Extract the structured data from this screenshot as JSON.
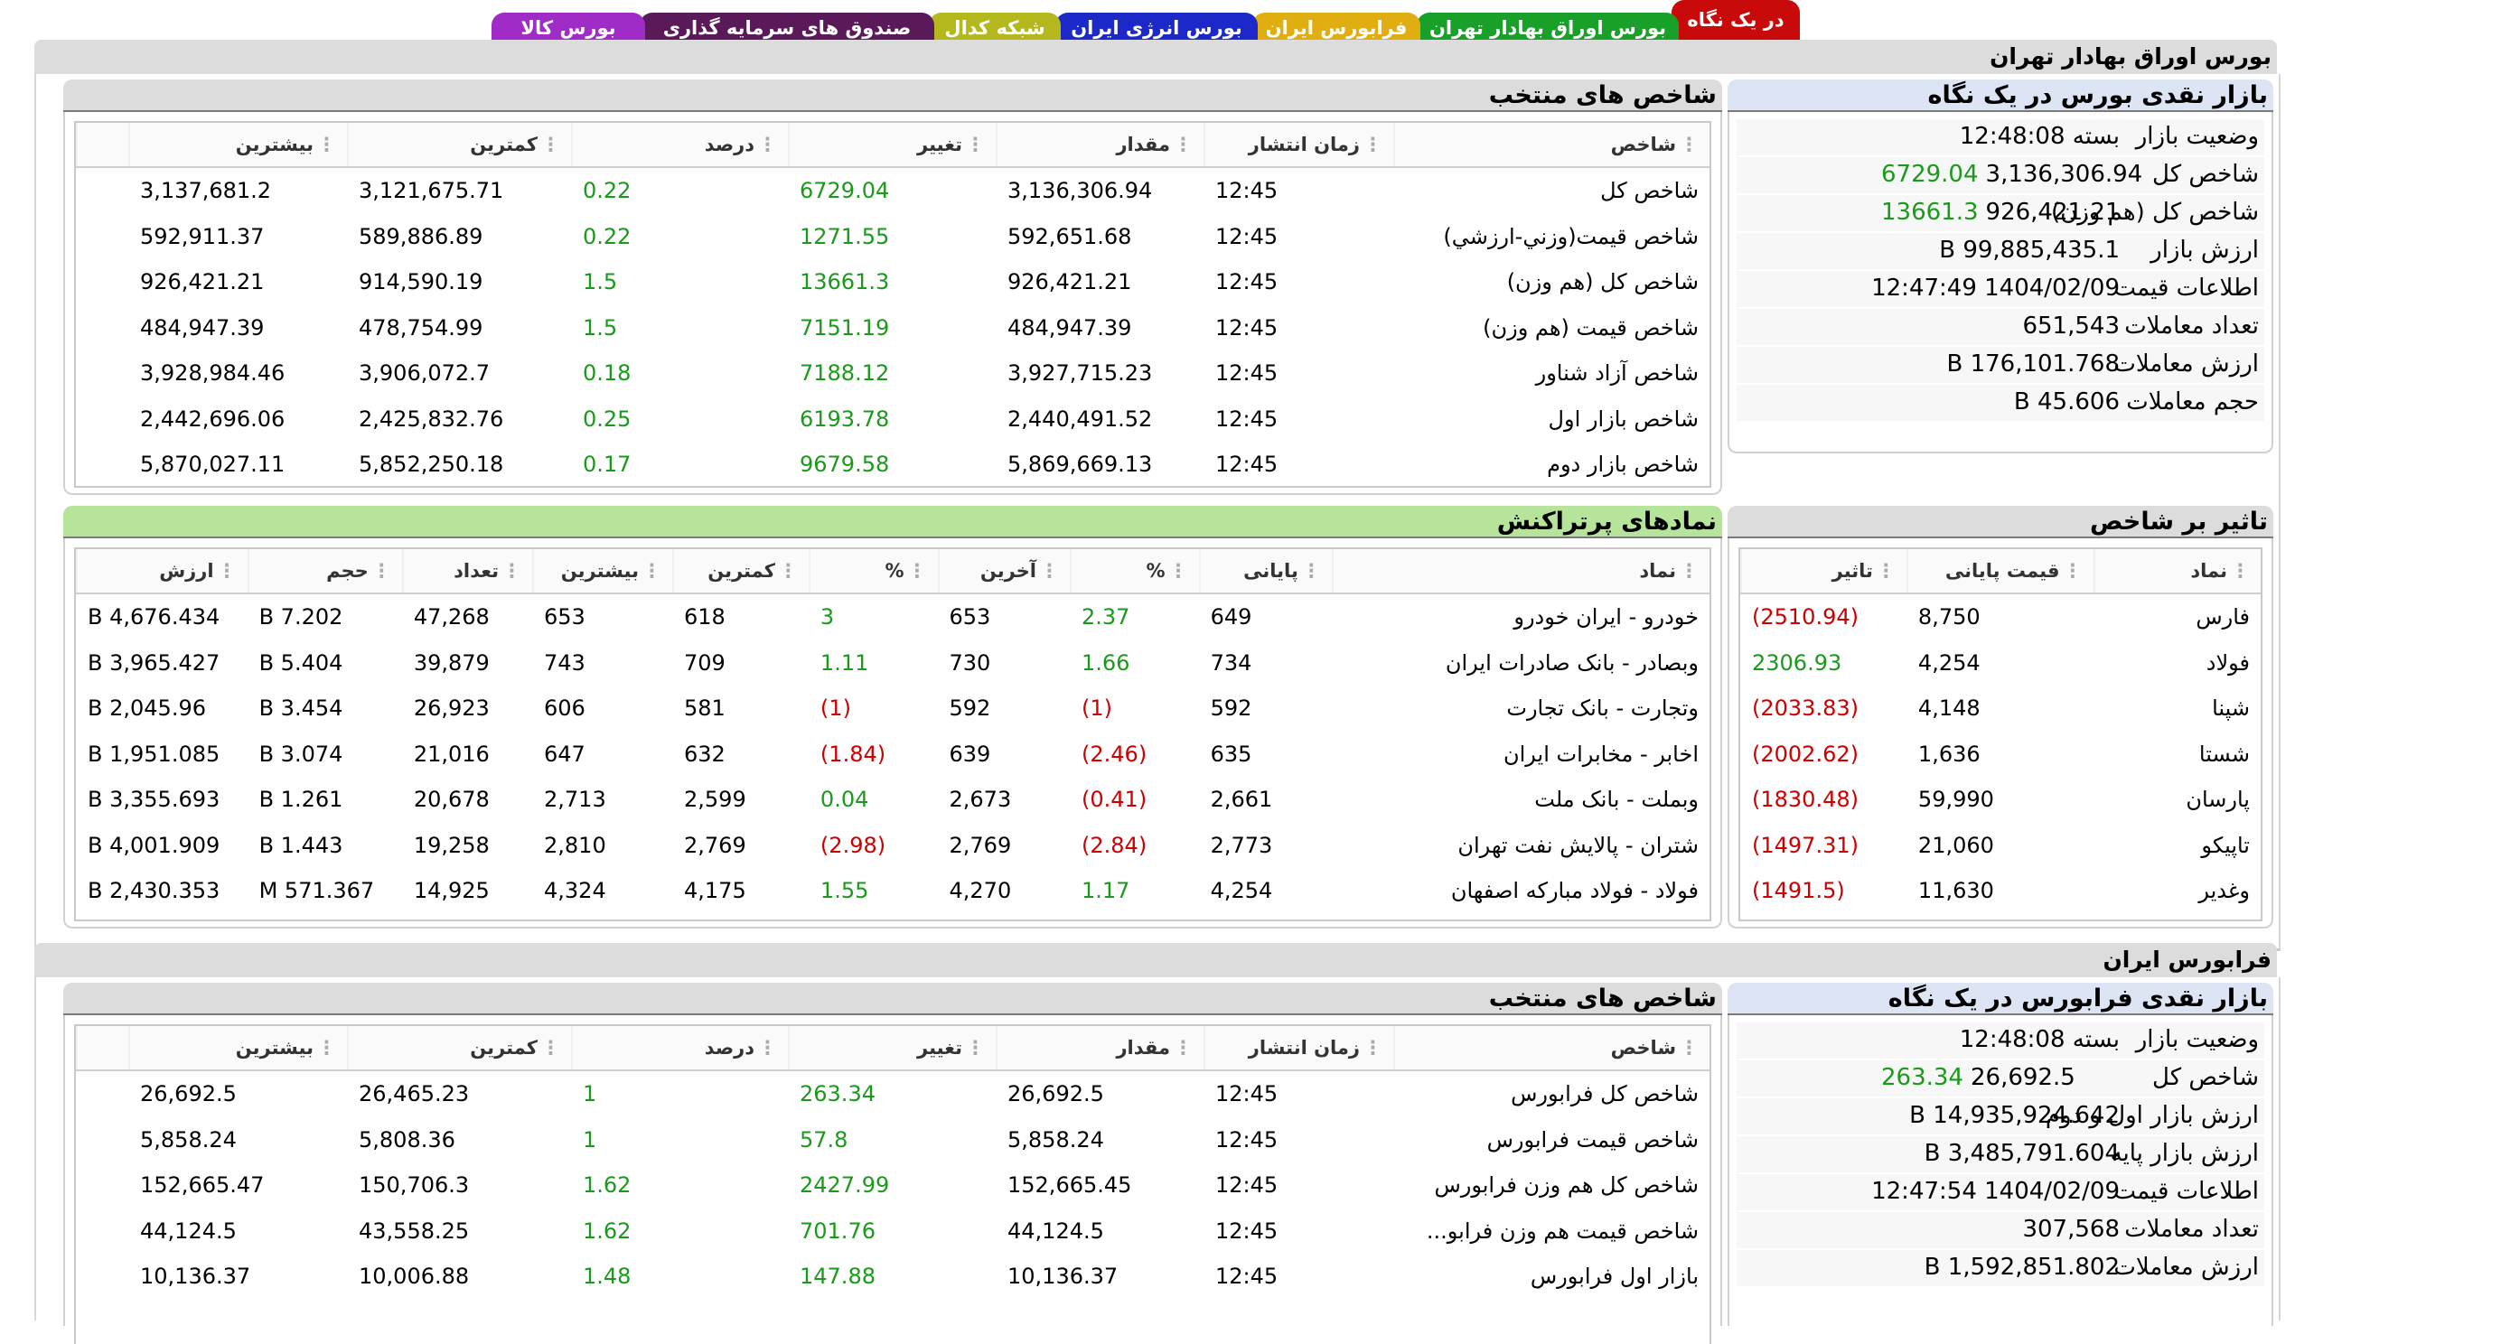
{
  "tabs": [
    {
      "label": "در یک نگاه",
      "color": "#c80a0a",
      "active": true
    },
    {
      "label": "بورس اوراق بهادار تهران",
      "color": "#18a028"
    },
    {
      "label": "فرابورس ایران",
      "color": "#e0ae10"
    },
    {
      "label": "بورس انرژی ایران",
      "color": "#1c28c8"
    },
    {
      "label": "شبکه کدال",
      "color": "#b4b81c"
    },
    {
      "label": "صندوق های سرمایه گذاری",
      "color": "#5a1a5a"
    },
    {
      "label": "بورس کالا",
      "color": "#a02cc8"
    }
  ],
  "tehran": {
    "title": "بورس اوراق بهادار تهران",
    "summary": {
      "title": "بازار نقدی بورس در یک نگاه",
      "rows": [
        {
          "label": "وضعیت بازار",
          "value": "بسته 12:48:08"
        },
        {
          "label": "شاخص کل",
          "value": "3,136,306.94",
          "change": "6729.04"
        },
        {
          "label": "شاخص کل (هم وزن)",
          "value": "926,421.21",
          "change": "13661.3"
        },
        {
          "label": "ارزش بازار",
          "value": "99,885,435.1 B"
        },
        {
          "label": "اطلاعات قیمت",
          "value": "1404/02/09 12:47:49"
        },
        {
          "label": "تعداد معاملات",
          "value": "651,543"
        },
        {
          "label": "ارزش معاملات",
          "value": "176,101.768 B"
        },
        {
          "label": "حجم معاملات",
          "value": "45.606 B"
        }
      ]
    },
    "indices": {
      "title": "شاخص های منتخب",
      "headers": [
        "شاخص",
        "زمان انتشار",
        "مقدار",
        "تغییر",
        "درصد",
        "کمترین",
        "بیشترین"
      ],
      "rows": [
        [
          "شاخص کل",
          "12:45",
          "3,136,306.94",
          "6729.04",
          "0.22",
          "3,121,675.71",
          "3,137,681.2"
        ],
        [
          "شاخص قيمت(وزني-ارزشي)",
          "12:45",
          "592,651.68",
          "1271.55",
          "0.22",
          "589,886.89",
          "592,911.37"
        ],
        [
          "شاخص کل (هم وزن)",
          "12:45",
          "926,421.21",
          "13661.3",
          "1.5",
          "914,590.19",
          "926,421.21"
        ],
        [
          "شاخص قیمت (هم وزن)",
          "12:45",
          "484,947.39",
          "7151.19",
          "1.5",
          "478,754.99",
          "484,947.39"
        ],
        [
          "شاخص آزاد شناور",
          "12:45",
          "3,927,715.23",
          "7188.12",
          "0.18",
          "3,906,072.7",
          "3,928,984.46"
        ],
        [
          "شاخص بازار اول",
          "12:45",
          "2,440,491.52",
          "6193.78",
          "0.25",
          "2,425,832.76",
          "2,442,696.06"
        ],
        [
          "شاخص بازار دوم",
          "12:45",
          "5,869,669.13",
          "9679.58",
          "0.17",
          "5,852,250.18",
          "5,870,027.11"
        ]
      ]
    },
    "impact": {
      "title": "تاثیر بر شاخص",
      "headers": [
        "نماد",
        "قیمت پایانی",
        "تاثیر"
      ],
      "rows": [
        [
          "فارس",
          "8,750",
          "(2510.94)"
        ],
        [
          "فولاد",
          "4,254",
          "2306.93"
        ],
        [
          "شپنا",
          "4,148",
          "(2033.83)"
        ],
        [
          "شستا",
          "1,636",
          "(2002.62)"
        ],
        [
          "پارسان",
          "59,990",
          "(1830.48)"
        ],
        [
          "تاپیکو",
          "21,060",
          "(1497.31)"
        ],
        [
          "وغدیر",
          "11,630",
          "(1491.5)"
        ]
      ]
    },
    "active": {
      "title": "نمادهای پرتراکنش",
      "headers": [
        "نماد",
        "پایانی",
        "%",
        "آخرین",
        "%",
        "کمترین",
        "بیشترین",
        "تعداد",
        "حجم",
        "ارزش"
      ],
      "rows": [
        [
          "خودرو - ایران خودرو",
          "649",
          "2.37",
          "653",
          "3",
          "618",
          "653",
          "47,268",
          "7.202 B",
          "4,676.434 B"
        ],
        [
          "وبصادر - بانک صادرات ایران",
          "734",
          "1.66",
          "730",
          "1.11",
          "709",
          "743",
          "39,879",
          "5.404 B",
          "3,965.427 B"
        ],
        [
          "وتجارت - بانک تجارت",
          "592",
          "(1)",
          "592",
          "(1)",
          "581",
          "606",
          "26,923",
          "3.454 B",
          "2,045.96 B"
        ],
        [
          "اخابر - مخابرات ایران",
          "635",
          "(2.46)",
          "639",
          "(1.84)",
          "632",
          "647",
          "21,016",
          "3.074 B",
          "1,951.085 B"
        ],
        [
          "وبملت - بانک ملت",
          "2,661",
          "(0.41)",
          "2,673",
          "0.04",
          "2,599",
          "2,713",
          "20,678",
          "1.261 B",
          "3,355.693 B"
        ],
        [
          "شتران - پالایش نفت تهران",
          "2,773",
          "(2.84)",
          "2,769",
          "(2.98)",
          "2,769",
          "2,810",
          "19,258",
          "1.443 B",
          "4,001.909 B"
        ],
        [
          "فولاد - فولاد مبارکه اصفهان",
          "4,254",
          "1.17",
          "4,270",
          "1.55",
          "4,175",
          "4,324",
          "14,925",
          "571.367 M",
          "2,430.353 B"
        ]
      ]
    }
  },
  "farabourse": {
    "title": "فرابورس ایران",
    "summary": {
      "title": "بازار نقدی فرابورس در یک نگاه",
      "rows": [
        {
          "label": "وضعیت بازار",
          "value": "بسته 12:48:08"
        },
        {
          "label": "شاخص کل",
          "value": "26,692.5",
          "change": "263.34"
        },
        {
          "label": "ارزش بازار اول و دوم",
          "value": "14,935,924.642 B"
        },
        {
          "label": "ارزش بازار پایه",
          "value": "3,485,791.604 B"
        },
        {
          "label": "اطلاعات قیمت",
          "value": "1404/02/09 12:47:54"
        },
        {
          "label": "تعداد معاملات",
          "value": "307,568"
        },
        {
          "label": "ارزش معاملات",
          "value": "1,592,851.802 B"
        }
      ]
    },
    "indices": {
      "title": "شاخص های منتخب",
      "headers": [
        "شاخص",
        "زمان انتشار",
        "مقدار",
        "تغییر",
        "درصد",
        "کمترین",
        "بیشترین"
      ],
      "rows": [
        [
          "شاخص کل فرابورس",
          "12:45",
          "26,692.5",
          "263.34",
          "1",
          "26,465.23",
          "26,692.5"
        ],
        [
          "شاخص قیمت فرابورس",
          "12:45",
          "5,858.24",
          "57.8",
          "1",
          "5,808.36",
          "5,858.24"
        ],
        [
          "شاخص کل هم وزن فرابورس",
          "12:45",
          "152,665.45",
          "2427.99",
          "1.62",
          "150,706.3",
          "152,665.47"
        ],
        [
          "شاخص قیمت هم وزن فرابو...",
          "12:45",
          "44,124.5",
          "701.76",
          "1.62",
          "43,558.25",
          "44,124.5"
        ],
        [
          "بازار اول فرابورس",
          "12:45",
          "10,136.37",
          "147.88",
          "1.48",
          "10,006.88",
          "10,136.37"
        ]
      ]
    }
  }
}
